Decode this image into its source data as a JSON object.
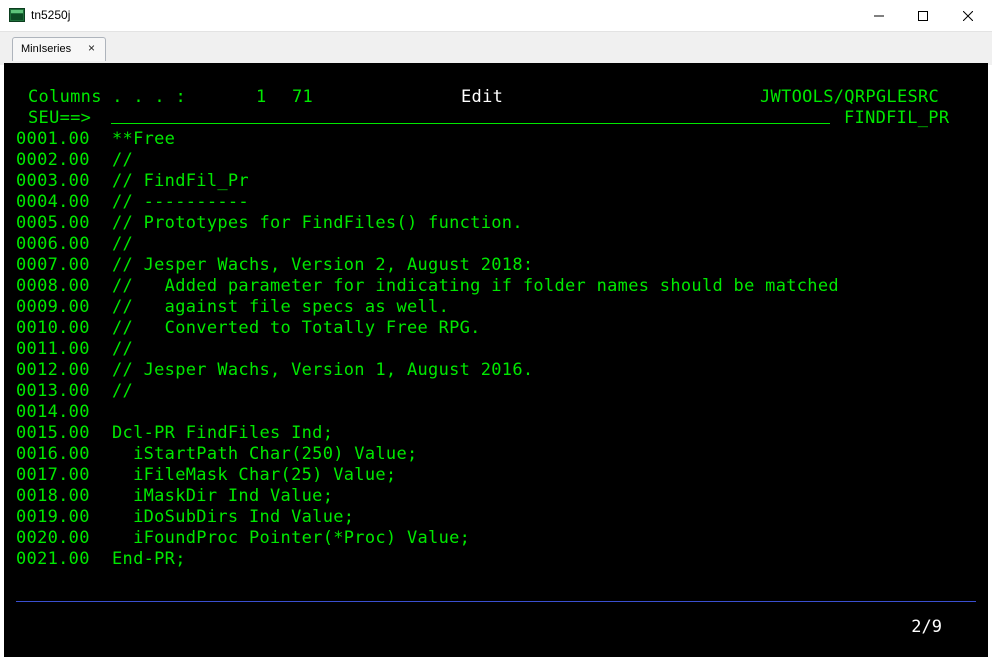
{
  "window": {
    "title": "tn5250j",
    "controls": [
      "minimize-icon",
      "maximize-icon",
      "close-icon"
    ]
  },
  "tabs": [
    {
      "label": "MinIseries",
      "close": "×"
    }
  ],
  "screen": {
    "header": {
      "columns_label": "Columns . . . :",
      "columns_from": "1",
      "columns_to": "71",
      "mode": "Edit",
      "library_file": "JWTOOLS/QRPGLESRC",
      "prompt": "SEU==>",
      "member": "FINDFIL_PR"
    },
    "lines": [
      {
        "seq": "0001.00",
        "text": "**Free"
      },
      {
        "seq": "0002.00",
        "text": "//"
      },
      {
        "seq": "0003.00",
        "text": "// FindFil_Pr"
      },
      {
        "seq": "0004.00",
        "text": "// ----------"
      },
      {
        "seq": "0005.00",
        "text": "// Prototypes for FindFiles() function."
      },
      {
        "seq": "0006.00",
        "text": "//"
      },
      {
        "seq": "0007.00",
        "text": "// Jesper Wachs, Version 2, August 2018:"
      },
      {
        "seq": "0008.00",
        "text": "//   Added parameter for indicating if folder names should be matched"
      },
      {
        "seq": "0009.00",
        "text": "//   against file specs as well."
      },
      {
        "seq": "0010.00",
        "text": "//   Converted to Totally Free RPG."
      },
      {
        "seq": "0011.00",
        "text": "//"
      },
      {
        "seq": "0012.00",
        "text": "// Jesper Wachs, Version 1, August 2016."
      },
      {
        "seq": "0013.00",
        "text": "//"
      },
      {
        "seq": "0014.00",
        "text": ""
      },
      {
        "seq": "0015.00",
        "text": "Dcl-PR FindFiles Ind;"
      },
      {
        "seq": "0016.00",
        "text": "  iStartPath Char(250) Value;"
      },
      {
        "seq": "0017.00",
        "text": "  iFileMask Char(25) Value;"
      },
      {
        "seq": "0018.00",
        "text": "  iMaskDir Ind Value;"
      },
      {
        "seq": "0019.00",
        "text": "  iDoSubDirs Ind Value;"
      },
      {
        "seq": "0020.00",
        "text": "  iFoundProc Pointer(*Proc) Value;"
      },
      {
        "seq": "0021.00",
        "text": "End-PR;"
      }
    ],
    "status": "2/9"
  },
  "colors": {
    "terminal_bg": "#000000",
    "text_green": "#00e800",
    "text_white": "#ffffff",
    "separator_blue": "#3a4fd0"
  }
}
